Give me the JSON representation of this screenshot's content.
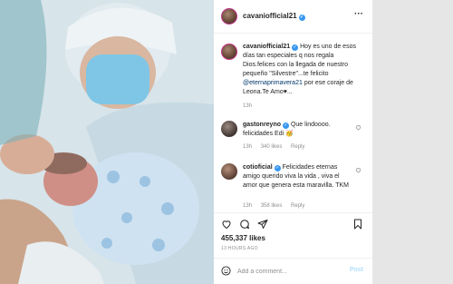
{
  "post": {
    "username": "cavaniofficial21",
    "more_icon": "more-horizontal-icon",
    "caption_user": "cavaniofficial21",
    "caption_text_1": "Hoy es uno de esos días tan especiales q nos regala Dios.felices con la llegada de nuestro pequeño \"Silvestre\"...te felicito",
    "caption_mention": "@eternaprimavera21",
    "caption_text_2": "por ese coraje de Leona.Te Amo♥...",
    "caption_time": "13h"
  },
  "comments": [
    {
      "user": "gastonreyno",
      "text": "Que lindoooo. felicidades Edi 🥳",
      "time": "13h",
      "likes": "340 likes",
      "reply": "Reply"
    },
    {
      "user": "cotioficial",
      "text": "Felicidades eternas amigo querido viva la vida , viva el amor que genera esta maravilla. TKM",
      "time": "13h",
      "likes": "358 likes",
      "reply": "Reply"
    }
  ],
  "stats": {
    "likes": "455,337 likes",
    "ago": "13 HOURS AGO"
  },
  "add_comment": {
    "placeholder": "Add a comment...",
    "post_label": "Post"
  },
  "colors": {
    "verified": "#3897f0",
    "post_disabled": "#b2dffc",
    "mention": "#00376b"
  }
}
